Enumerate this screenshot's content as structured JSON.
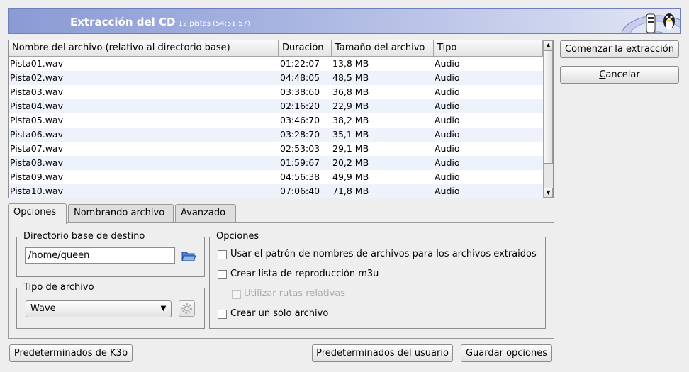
{
  "header": {
    "title": "Extracción del CD",
    "subtitle": "12 pistas (54:51:57)"
  },
  "filelist": {
    "columns": [
      "Nombre del archivo (relativo al directorio base)",
      "Duración",
      "Tamaño del archivo",
      "Tipo"
    ],
    "rows": [
      {
        "name": "Pista01.wav",
        "duration": "01:22:07",
        "size": "13,8 MB",
        "type": "Audio"
      },
      {
        "name": "Pista02.wav",
        "duration": "04:48:05",
        "size": "48,5 MB",
        "type": "Audio"
      },
      {
        "name": "Pista03.wav",
        "duration": "03:38:60",
        "size": "36,8 MB",
        "type": "Audio"
      },
      {
        "name": "Pista04.wav",
        "duration": "02:16:20",
        "size": "22,9 MB",
        "type": "Audio"
      },
      {
        "name": "Pista05.wav",
        "duration": "03:46:70",
        "size": "38,2 MB",
        "type": "Audio"
      },
      {
        "name": "Pista06.wav",
        "duration": "03:28:70",
        "size": "35,1 MB",
        "type": "Audio"
      },
      {
        "name": "Pista07.wav",
        "duration": "02:53:03",
        "size": "29,1 MB",
        "type": "Audio"
      },
      {
        "name": "Pista08.wav",
        "duration": "01:59:67",
        "size": "20,2 MB",
        "type": "Audio"
      },
      {
        "name": "Pista09.wav",
        "duration": "04:56:38",
        "size": "49,9 MB",
        "type": "Audio"
      },
      {
        "name": "Pista10.wav",
        "duration": "07:06:40",
        "size": "71,8 MB",
        "type": "Audio"
      }
    ]
  },
  "actions": {
    "start_label": "Comenzar la extracción",
    "cancel_label": "Cancelar"
  },
  "tabs": {
    "options": "Opciones",
    "naming": "Nombrando archivo",
    "advanced": "Avanzado"
  },
  "destination": {
    "title": "Directorio base de destino",
    "path": "/home/queen",
    "folder_icon": "folder-open-icon"
  },
  "filetype": {
    "title": "Tipo de archivo",
    "selected": "Wave",
    "config_icon": "gear-icon"
  },
  "options": {
    "title": "Opciones",
    "use_pattern": "Usar el patrón de nombres de archivos para los archivos extraidos",
    "create_playlist": "Crear lista de reproducción m3u",
    "relative_paths": "Utilizar rutas relativas",
    "single_file": "Crear un solo archivo"
  },
  "footer": {
    "k3b_defaults": "Predeterminados de K3b",
    "user_defaults": "Predeterminados del usuario",
    "save_options": "Guardar opciones"
  },
  "colors": {
    "banner_start": "#8a9bd4",
    "banner_end": "#e4e7f4",
    "row_alt": "#eef3fb"
  }
}
